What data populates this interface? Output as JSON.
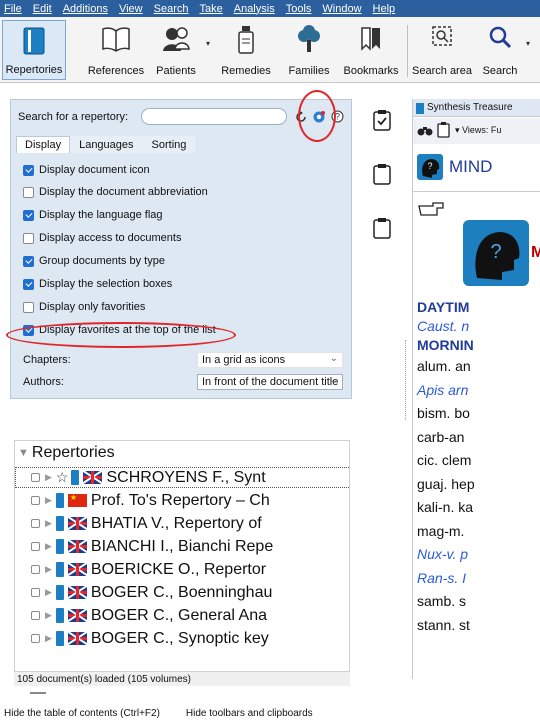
{
  "menu": [
    "File",
    "Edit",
    "Additions",
    "View",
    "Search",
    "Take",
    "Analysis",
    "Tools",
    "Window",
    "Help"
  ],
  "toolbar": {
    "repertories": "Repertories",
    "references": "References",
    "patients": "Patients",
    "remedies": "Remedies",
    "families": "Families",
    "bookmarks": "Bookmarks",
    "search_area": "Search area",
    "search": "Search"
  },
  "search_panel": {
    "label": "Search for a repertory:",
    "value": "",
    "tabs": [
      "Display",
      "Languages",
      "Sorting"
    ],
    "options": [
      {
        "label": "Display document icon",
        "checked": true
      },
      {
        "label": "Display the document abbreviation",
        "checked": false
      },
      {
        "label": "Display the language flag",
        "checked": true
      },
      {
        "label": "Display access to documents",
        "checked": false
      },
      {
        "label": "Group documents by type",
        "checked": true
      },
      {
        "label": "Display the selection boxes",
        "checked": true
      },
      {
        "label": "Display only favorities",
        "checked": false
      },
      {
        "label": "Display favorites at the top of the list",
        "checked": true
      }
    ],
    "chapters_label": "Chapters:",
    "chapters_value": "In a grid as icons",
    "authors_label": "Authors:",
    "authors_value": "In front of the document title"
  },
  "tree": {
    "header": "Repertories",
    "items": [
      {
        "label": "SCHROYENS F., Synt",
        "flag": "uk",
        "star": true
      },
      {
        "label": "Prof. To's Repertory – Ch",
        "flag": "cn",
        "star": false
      },
      {
        "label": "BHATIA V., Repertory of",
        "flag": "uk",
        "star": false
      },
      {
        "label": "BIANCHI I., Bianchi Repe",
        "flag": "uk",
        "star": false
      },
      {
        "label": "BOERICKE O., Repertor",
        "flag": "uk",
        "star": false
      },
      {
        "label": "BOGER C., Boenninghau",
        "flag": "uk",
        "star": false
      },
      {
        "label": "BOGER C., General Ana",
        "flag": "uk",
        "star": false
      },
      {
        "label": "BOGER C., Synoptic key",
        "flag": "uk",
        "star": false
      }
    ],
    "status": "105 document(s) loaded (105 volumes)"
  },
  "bottom": {
    "hide_toc": "Hide the table of contents (Ctrl+F2)",
    "hide_toolbars": "Hide toolbars and clipboards"
  },
  "right_pane": {
    "tab": "Synthesis Treasure",
    "views": "Views: Fu",
    "chapter": "MIND",
    "heading_letter": "M",
    "lines": [
      {
        "text": "DAYTIM",
        "style": "bold"
      },
      {
        "text": "Caust. n",
        "style": "ital"
      },
      {
        "text": "MORNIN",
        "style": "bold"
      },
      {
        "text": "alum. an",
        "style": "plain"
      },
      {
        "text": "Apis arn",
        "style": "ital"
      },
      {
        "text": "bism. bo",
        "style": "plain"
      },
      {
        "text": "carb-an",
        "style": "plain"
      },
      {
        "text": "cic. clem",
        "style": "plain"
      },
      {
        "text": "guaj. hep",
        "style": "plain"
      },
      {
        "text": "kali-n. ka",
        "style": "plain"
      },
      {
        "text": "mag-m.",
        "style": "plain"
      },
      {
        "text": "Nux-v. p",
        "style": "ital"
      },
      {
        "text": "Ran-s. I",
        "style": "ital"
      },
      {
        "text": "samb. s",
        "style": "plain"
      },
      {
        "text": "stann. st",
        "style": "plain"
      }
    ]
  },
  "colors": {
    "menubar": "#2b5f9e",
    "accent": "#1f6fd1",
    "annotation": "#e0262b"
  }
}
